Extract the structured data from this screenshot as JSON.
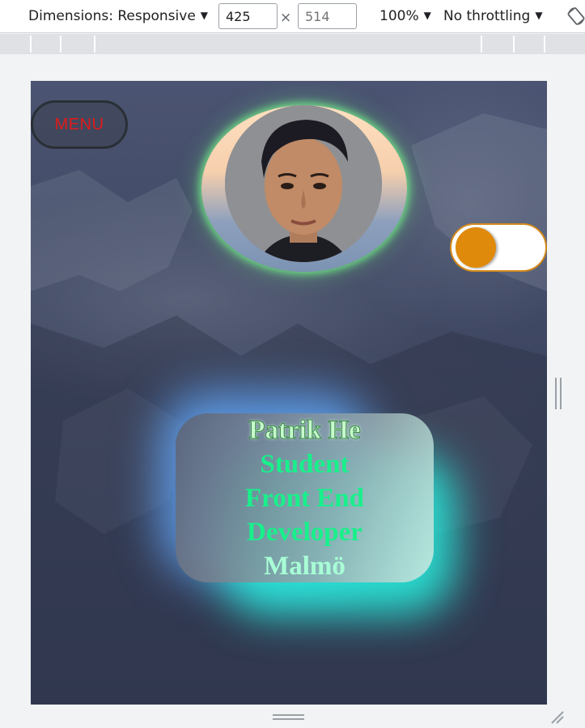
{
  "toolbar": {
    "dimensions_label": "Dimensions: Responsive",
    "width_value": "425",
    "height_placeholder": "514",
    "times_sign": "×",
    "zoom_label": "100%",
    "throttling_label": "No throttling",
    "caret": "▼",
    "rotate_icon": "rotate-device-icon"
  },
  "page": {
    "menu_label": "MENU",
    "profile_icon": "profile-photo",
    "toggle": {
      "state": "off",
      "knob_color": "#e08a0c",
      "border_color": "#d38a1a"
    },
    "card": {
      "lines": [
        "Patrik He",
        "Student",
        "Front End",
        "Developer",
        "Malmö"
      ]
    }
  },
  "colors": {
    "menu_text": "#e01b1b",
    "name_text": "#c9ffd0",
    "title_text": "#19f08b",
    "city_text": "#a8ffd6",
    "avatar_glow": "#78ff8c",
    "card_glow_blue": "#64aaff",
    "card_glow_cyan": "#28e6d7"
  }
}
